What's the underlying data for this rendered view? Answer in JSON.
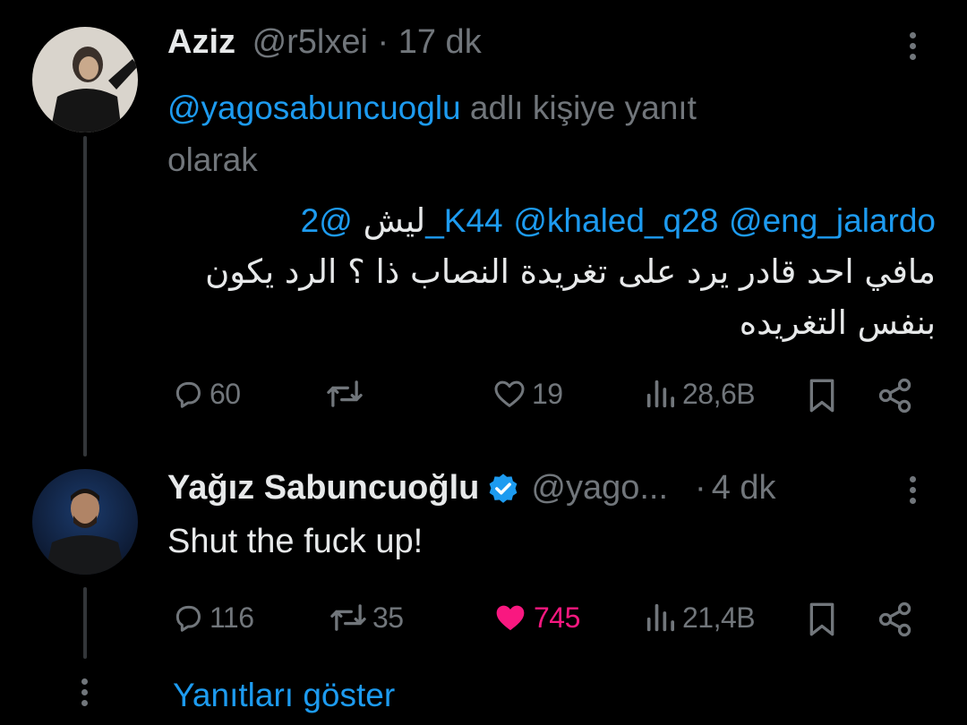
{
  "tweet1": {
    "display_name": "Aziz",
    "handle": "@r5lxei",
    "separator": "·",
    "time": "17 dk",
    "reply_to_handle": "@yagosabuncuoglu",
    "reply_to_text_1": "adlı kişiye yanıt",
    "reply_to_text_2": "olarak",
    "mention_1": "@2_K44",
    "mention_2": "@khaled_q28",
    "mention_3": "@eng_jalardo",
    "word_lish": "ليش",
    "body_line_2": "مافي احد قادر يرد على تغريدة النصاب ذا ؟ الرد يكون",
    "body_line_3": "بنفس التغريده",
    "replies": "60",
    "retweets": "",
    "likes": "19",
    "views": "28,6B"
  },
  "tweet2": {
    "display_name": "Yağız Sabuncuoğlu",
    "handle": "@yago...",
    "separator": "·",
    "time": "4 dk",
    "body": "Shut the fuck up!",
    "replies": "116",
    "retweets": "35",
    "likes": "745",
    "views": "21,4B"
  },
  "show_replies": "Yanıtları göster",
  "colors": {
    "background": "#000000",
    "link": "#1d9bf0",
    "muted": "#71767b",
    "like_active": "#f91880",
    "verified": "#1d9bf0"
  }
}
